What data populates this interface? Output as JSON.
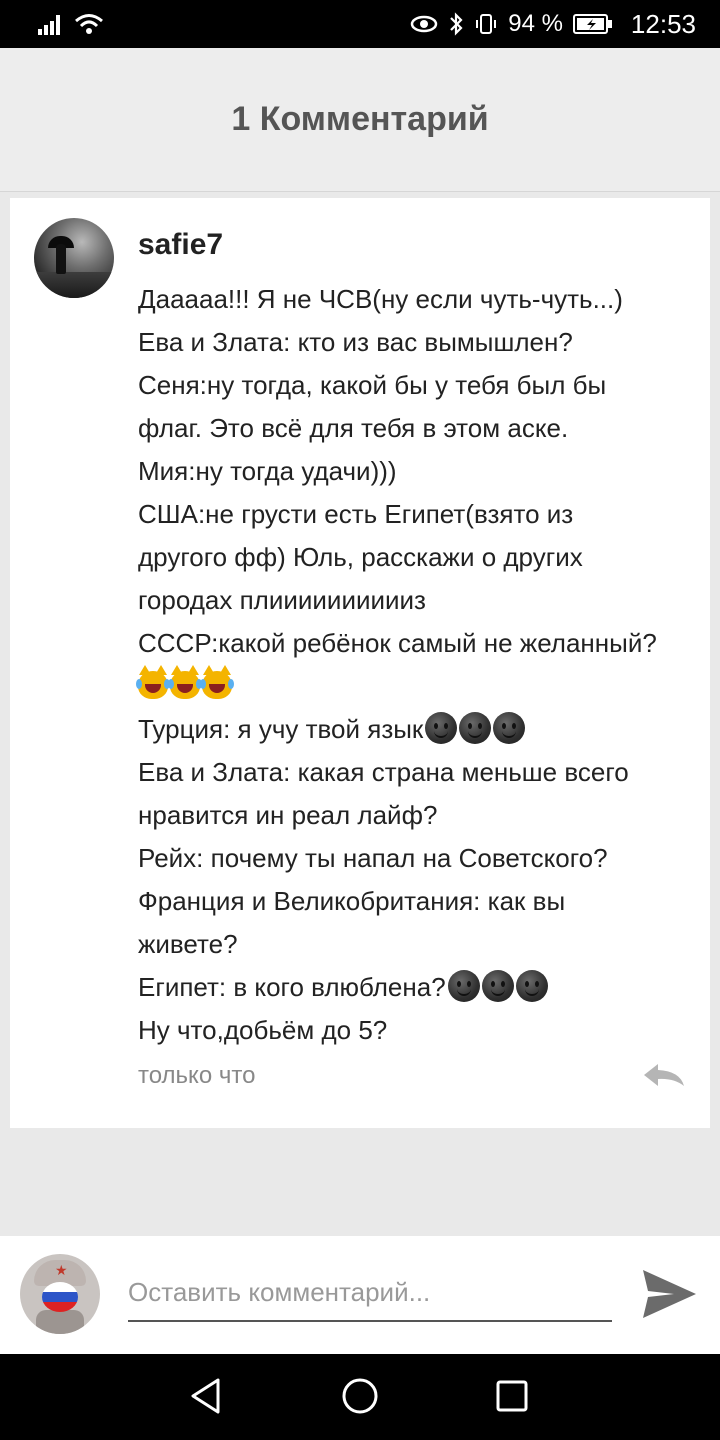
{
  "status_bar": {
    "battery_percent": "94 %",
    "time": "12:53",
    "icons": [
      "signal-icon",
      "wifi-icon",
      "eye-icon",
      "bluetooth-icon",
      "vibrate-icon",
      "battery-charging-icon"
    ]
  },
  "header": {
    "title": "1 Комментарий"
  },
  "comment": {
    "username": "safie7",
    "lines": [
      "Дааааа!!! Я не ЧСВ(ну если чуть-чуть...)",
      "Ева и Злата: кто из вас вымышлен?",
      "Сеня:ну тогда, какой бы у тебя был бы",
      "флаг. Это всё для тебя в этом аске.",
      "Мия:ну тогда удачи)))",
      "США:не грусти есть Египет(взято из",
      "другого фф) Юль, расскажи о других",
      "городах плииииииииииз",
      "СССР:какой ребёнок самый не желанный?",
      "",
      "Турция: я учу твой язык",
      "Ева и Злата: какая страна меньше всего",
      "нравится ин реал лайф?",
      "Рейх: почему ты напал на Советского?",
      "Франция и Великобритания: как вы",
      "живете?",
      "Египет: в кого влюблена?",
      "Ну что,добьём до 5?"
    ],
    "timestamp": "только что"
  },
  "input_bar": {
    "placeholder": "Оставить комментарий..."
  },
  "colors": {
    "header_bg": "#ededed",
    "page_bg": "#e9e9e9",
    "status_bar": "#000000",
    "reply_icon": "#b5b5b5",
    "send_icon": "#6b6b6b"
  }
}
